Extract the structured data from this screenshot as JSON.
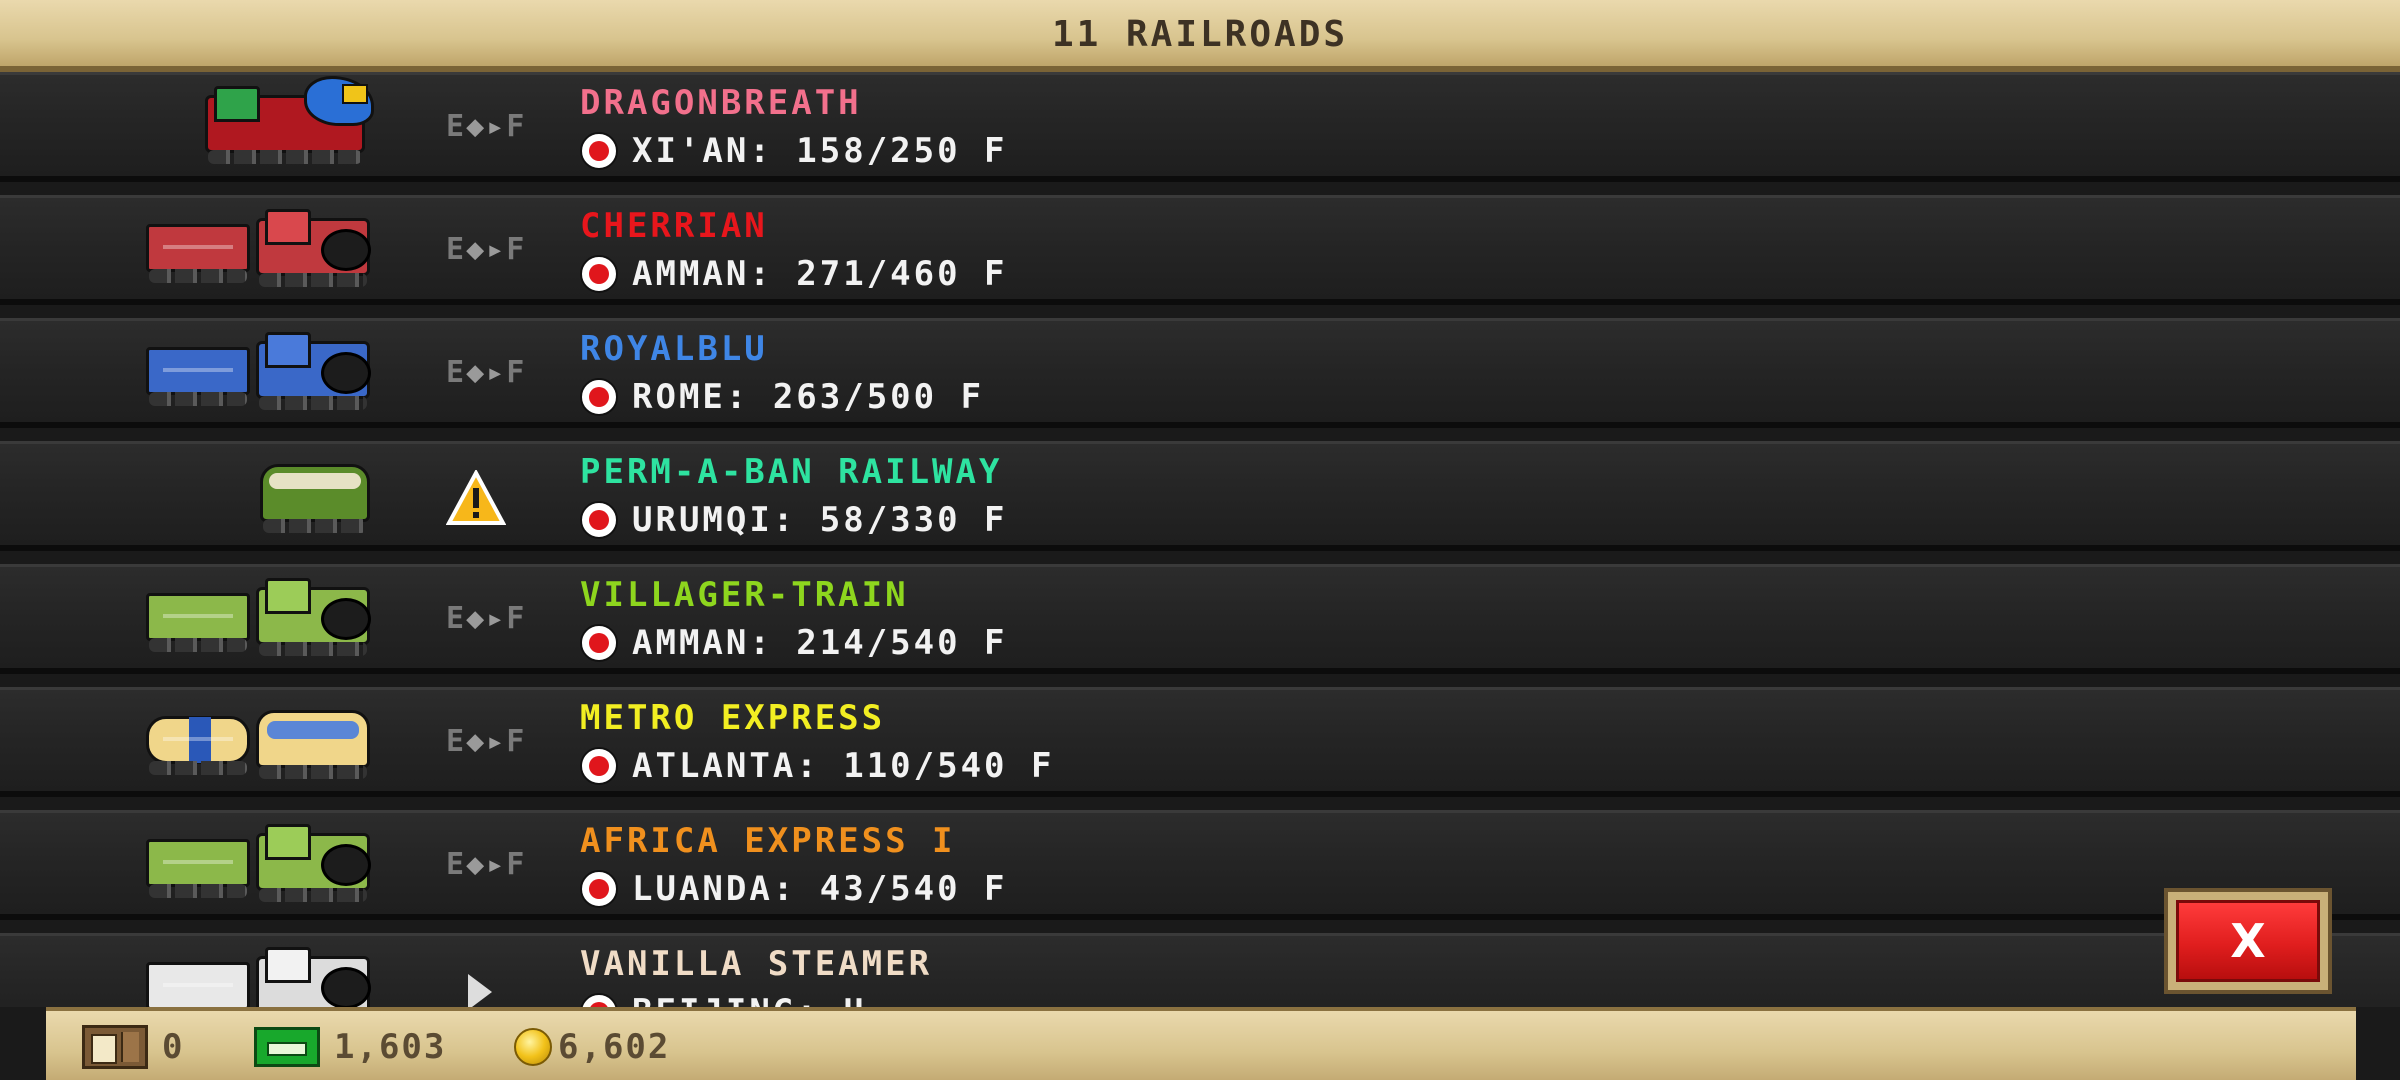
{
  "header": {
    "title": "11 RAILROADS"
  },
  "status_icon_text": {
    "left": "E",
    "right": "F"
  },
  "railroads": [
    {
      "name": "DRAGONBREATH",
      "name_color": "#f2708c",
      "destination": "XI'AN: 158/250 F",
      "status": "transfer",
      "train": "dragon"
    },
    {
      "name": "CHERRIAN",
      "name_color": "#e8161c",
      "destination": "AMMAN: 271/460 F",
      "status": "transfer",
      "train": "red-steam"
    },
    {
      "name": "ROYALBLU",
      "name_color": "#3f86e6",
      "destination": "ROME: 263/500 F",
      "status": "transfer",
      "train": "blue-steam"
    },
    {
      "name": "PERM-A-BAN RAILWAY",
      "name_color": "#2ee3a0",
      "destination": "URUMQI: 58/330 F",
      "status": "warning",
      "train": "green-diesel"
    },
    {
      "name": "VILLAGER-TRAIN",
      "name_color": "#8ed61e",
      "destination": "AMMAN: 214/540 F",
      "status": "transfer",
      "train": "lime-steam"
    },
    {
      "name": "METRO EXPRESS",
      "name_color": "#f2ee22",
      "destination": "ATLANTA: 110/540 F",
      "status": "transfer",
      "train": "tanker-diesel"
    },
    {
      "name": "AFRICA EXPRESS I",
      "name_color": "#f0901e",
      "destination": "LUANDA: 43/540 F",
      "status": "transfer",
      "train": "lime-steam"
    },
    {
      "name": "VANILLA STEAMER",
      "name_color": "#f0dcc6",
      "destination": "BEIJING: H...",
      "status": "moving",
      "train": "white-steam"
    }
  ],
  "close_button": {
    "label": "X"
  },
  "footer": {
    "crates": "0",
    "cash": "1,603",
    "coins": "6,602"
  },
  "icons": {
    "header": "none",
    "transfer": "e-arrow-f-icon",
    "warning": "warning-triangle-icon",
    "moving": "play-arrow-icon",
    "destination": "red-dot-icon",
    "crate": "crate-icon",
    "cash": "cash-icon",
    "coin": "gold-coin-icon"
  }
}
